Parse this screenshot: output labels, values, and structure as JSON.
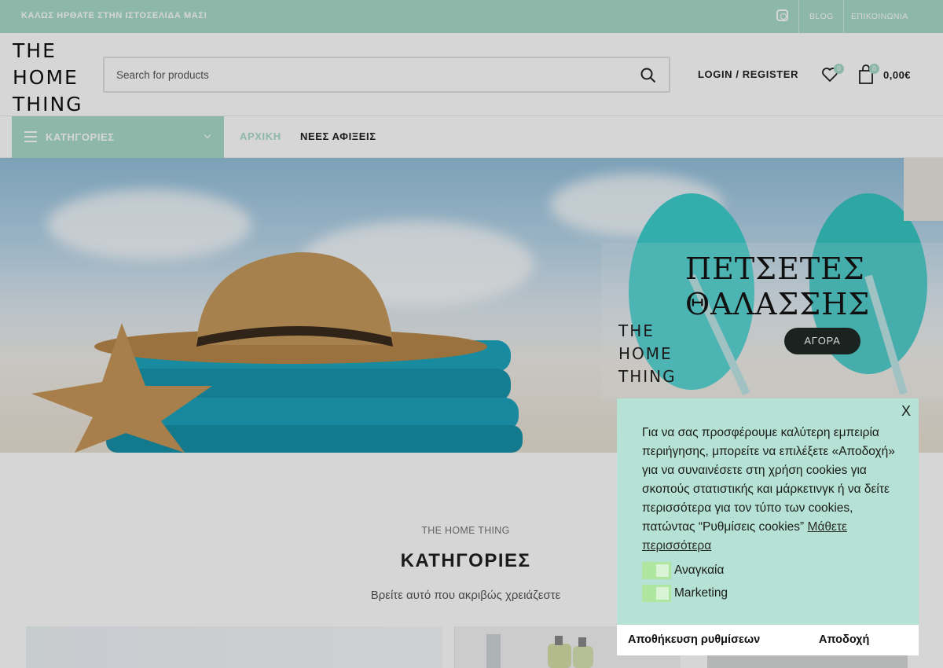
{
  "topbar": {
    "welcome": "ΚΑΛΩΣ ΗΡΘΑΤΕ ΣΤΗΝ ΙΣΤΟΣΕΛΙΔΑ ΜΑΣ!",
    "links": [
      {
        "label": "BLOG"
      },
      {
        "label": "ΕΠΙΚΟΙΝΩΝΙΑ"
      }
    ],
    "icon": "instagram-icon"
  },
  "header": {
    "logo": {
      "line1": "THE",
      "line2": "HOME",
      "line3": "THING"
    },
    "search_placeholder": "Search for products",
    "login_label": "LOGIN / REGISTER",
    "wishlist_count": "0",
    "cart_count": "0",
    "cart_total": "0,00€"
  },
  "nav": {
    "categories_label": "ΚΑΤΗΓΟΡΙΕΣ",
    "links": [
      {
        "label": "ΑΡΧΙΚΗ",
        "active": true
      },
      {
        "label": "ΝΕΕΣ ΑΦΙΞΕΙΣ",
        "active": false
      }
    ]
  },
  "hero": {
    "title": "ΠΕΤΣΕΤΕΣ ΘΑΛΑΣΣΗΣ",
    "button": "ΑΓΟΡΑ",
    "logo": {
      "line1": "THE",
      "line2": "HOME",
      "line3": "THING"
    }
  },
  "section": {
    "subtitle": "THE HOME THING",
    "title": "ΚΑΤΗΓΟΡΙΕΣ",
    "description": "Βρείτε αυτό που ακριβώς χρειάζεστε"
  },
  "cookie": {
    "close": "X",
    "message": "Για να σας προσφέρουμε καλύτερη εμπειρία περιήγησης, μπορείτε να επιλέξετε «Αποδοχή» για να συναινέσετε στη χρήση cookies για σκοπούς στατιστικής και μάρκετινγκ ή να δείτε περισσότερα για τον τύπο των cookies, πατώντας “Ρυθμίσεις cookies” ",
    "more_link": "Μάθετε περισσότερα",
    "options": [
      {
        "label": "Αναγκαία"
      },
      {
        "label": "Marketing"
      }
    ],
    "save_button": "Αποθήκευση ρυθμίσεων",
    "accept_button": "Αποδοχή"
  },
  "colors": {
    "brand": "#a9dcca",
    "cookie_bg": "#b5e2d4",
    "toggle": "#aee6a0",
    "button_dark": "#1f2a27"
  }
}
